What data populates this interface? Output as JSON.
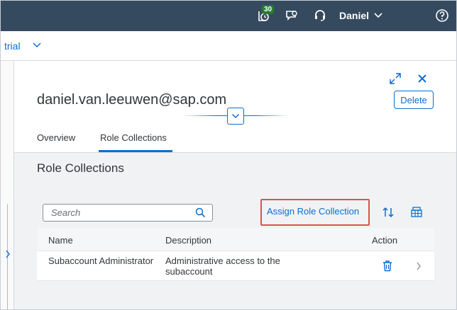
{
  "shell": {
    "notification_count": "30",
    "user_name": "Daniel",
    "icons": [
      "notifications-icon",
      "feedback-icon",
      "support-headset-icon",
      "help-icon"
    ]
  },
  "subbar": {
    "breadcrumb": "trial"
  },
  "object_header": {
    "title": "daniel.van.leeuwen@sap.com",
    "delete_label": "Delete"
  },
  "tabs": [
    {
      "label": "Overview",
      "selected": false
    },
    {
      "label": "Role Collections",
      "selected": true
    }
  ],
  "section": {
    "title": "Role Collections",
    "search_placeholder": "Search",
    "assign_label": "Assign Role Collection"
  },
  "table": {
    "columns": [
      "Name",
      "Description",
      "Action"
    ],
    "rows": [
      {
        "name": "Subaccount Administrator",
        "description": "Administrative access to the subaccount"
      }
    ]
  },
  "colors": {
    "shell": "#354a5f",
    "accent": "#0a6ed1",
    "highlight": "#d9534f",
    "badge": "#2b7c2b"
  }
}
